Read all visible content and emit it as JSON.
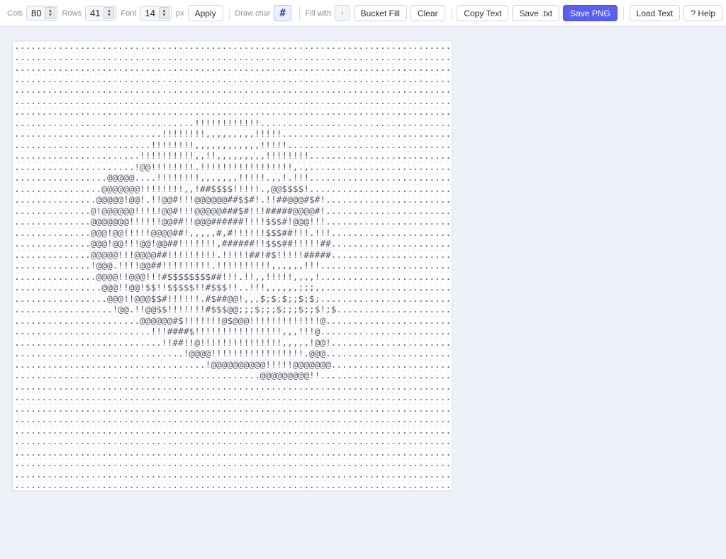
{
  "toolbar": {
    "cols_label": "Cols",
    "cols_value": "80",
    "rows_label": "Rows",
    "rows_value": "41",
    "font_label": "Font",
    "font_value": "14",
    "font_unit": "px",
    "apply_label": "Apply",
    "draw_char_label": "Draw char",
    "draw_char_value": "#",
    "fill_with_label": "Fill with",
    "fill_with_value": "·",
    "bucket_fill_label": "Bucket Fill",
    "clear_label": "Clear",
    "copy_text_label": "Copy Text",
    "save_txt_label": "Save .txt",
    "save_png_label": "Save PNG",
    "load_text_label": "Load Text",
    "help_label": "? Help"
  },
  "colors": {
    "primary_button": "#5b5fee",
    "draw_char_bg": "#eaf0ff",
    "page_bg": "#eef1f7"
  },
  "canvas": {
    "text": "................................................................................\n................................................................................\n................................................................................\n................................................................................\n................................................................................\n................................................................................\n................................................................................\n.................................!!!!!!!!!!!!...................................\n...........................!!!!!!!!,,,,,,,,,!!!!!...............................\n.........................!!!!!!!!,,,,,,,,,,,,!!!!!..............................\n.......................!!!!!!!!!!,,!!,,,,,,,,,!!!!!!!!..........................\n......................!@@!!!!!!!!.!!!!!!!!!!!!!!!!!,.,..........................\n.................@@@@@....!!!!!!!!,,,,,,,!!!!!.,,!.!!!..........................\n................@@@@@@@!!!!!!!!,,!##$$$$!!!!!.,@@$$$$!..........................\n...............@@@@@!@@!.!!@@#!!!@@@@@@##$$#!.!!##@@@#$#!.......................\n..............@!@@@@@@!!!!!@@#!!!@@@@@###$#!!!#####@@@@#!.......................\n..............@@@@@@@!!!!!!@@##!!@@@######!!!!$$$#!@@@!!!.......................\n..............@@@!@@!!!!!@@@@##!,,,,,#,#!!!!!!$$$##!!!.!!!......................\n..............@@@!@@!!!@@!@@##!!!!!!!,######!!$$$##!!!!!##......................\n..............@@@@@!!!@@@@##!!!!!!!!!.!!!!!##!#$!!!!!#####......................\n..............!@@@.!!!!@@##!!!!!!!!!.!!!!!!!!!!,,,,,,!!!........................\n...............@@@@!!@@@!!!#$$$$$$$$##!!!.!!,,!!!!!,,,,!........................\n................@@@!!@@!$$!!$$$$$!!#$$$!!..!!!,,,,,,;;;,,.......................\n.................@@@!!@@@$$#!!!!!!.#$##@@!,,,$;$;$;;$;$;........................\n..................!@@.!!@@$$!!!!!!!#$$$@@;;;$;;;$;;;$;;$!;$......................\n.......................@@@@@@#$!!!!!!!@$@@@!!!!!!!!!!!!!@........................\n.........................!!!####$!!!!!!!!!!!!!!!!,,,!!!@.........................\n...........................!!##!!@!!!!!!!!!!!!!!!,,,,,!@@!.......................\n...............................!@@@@!!!!!!!!!!!!!!!!!.@@@........................\n...................................!@@@@@@@@@@!!!!!@@@@@@@.......................\n.............................................@@@@@@@@@!!........................\n................................................................................\n................................................................................\n................................................................................\n................................................................................\n................................................................................\n................................................................................\n................................................................................\n................................................................................\n................................................................................\n................................................................................"
  }
}
